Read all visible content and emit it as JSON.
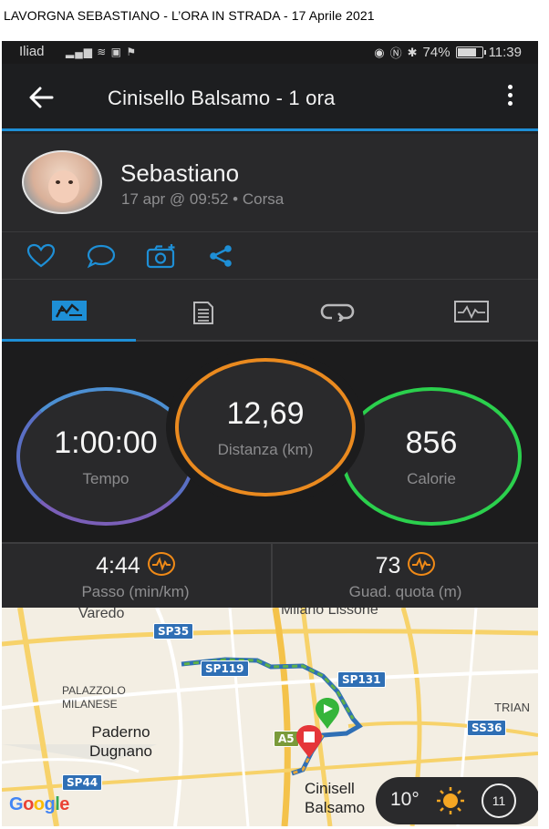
{
  "caption": "LAVORGNA SEBASTIANO  -  L’ORA IN STRADA  -  17 Aprile 2021",
  "status_bar": {
    "carrier": "Iliad",
    "battery": "74%",
    "battery_level": 0.74,
    "time": "11:39"
  },
  "app_bar": {
    "title": "Cinisello Balsamo - 1 ora"
  },
  "profile": {
    "name": "Sebastiano",
    "meta": "17 apr @ 09:52 • Corsa"
  },
  "actions": [
    "heart-icon",
    "comment-icon",
    "camera-add-icon",
    "share-icon"
  ],
  "tabs": [
    "stats-tab",
    "details-tab",
    "laps-tab",
    "charts-tab"
  ],
  "metrics": {
    "time": {
      "value": "1:00:00",
      "label": "Tempo",
      "color": "#5a6fc4"
    },
    "distance": {
      "value": "12,69",
      "label": "Distanza (km)",
      "color": "#ea8a1f"
    },
    "calories": {
      "value": "856",
      "label": "Calorie",
      "color": "#2bd04d"
    }
  },
  "sub_stats": {
    "pace": {
      "value": "4:44",
      "label": "Passo (min/km)"
    },
    "elevation": {
      "value": "73",
      "label": "Guad. quota (m)"
    }
  },
  "map": {
    "labels": {
      "varedo": "Varedo",
      "milano_lissone": "Milano Lissone",
      "palazzolo": "PALAZZOLO\nMILANESE",
      "trian": "TRIAN",
      "paderno": "Paderno\nDugnano",
      "cinisello": "Cinisell\nBalsamo"
    },
    "shields": {
      "sp35": "SP35",
      "sp119": "SP119",
      "sp131": "SP131",
      "a5": "A5",
      "ss36": "SS36",
      "sp44": "SP44"
    },
    "google": "Google",
    "weather": {
      "temp": "10°",
      "clock": "11"
    }
  }
}
